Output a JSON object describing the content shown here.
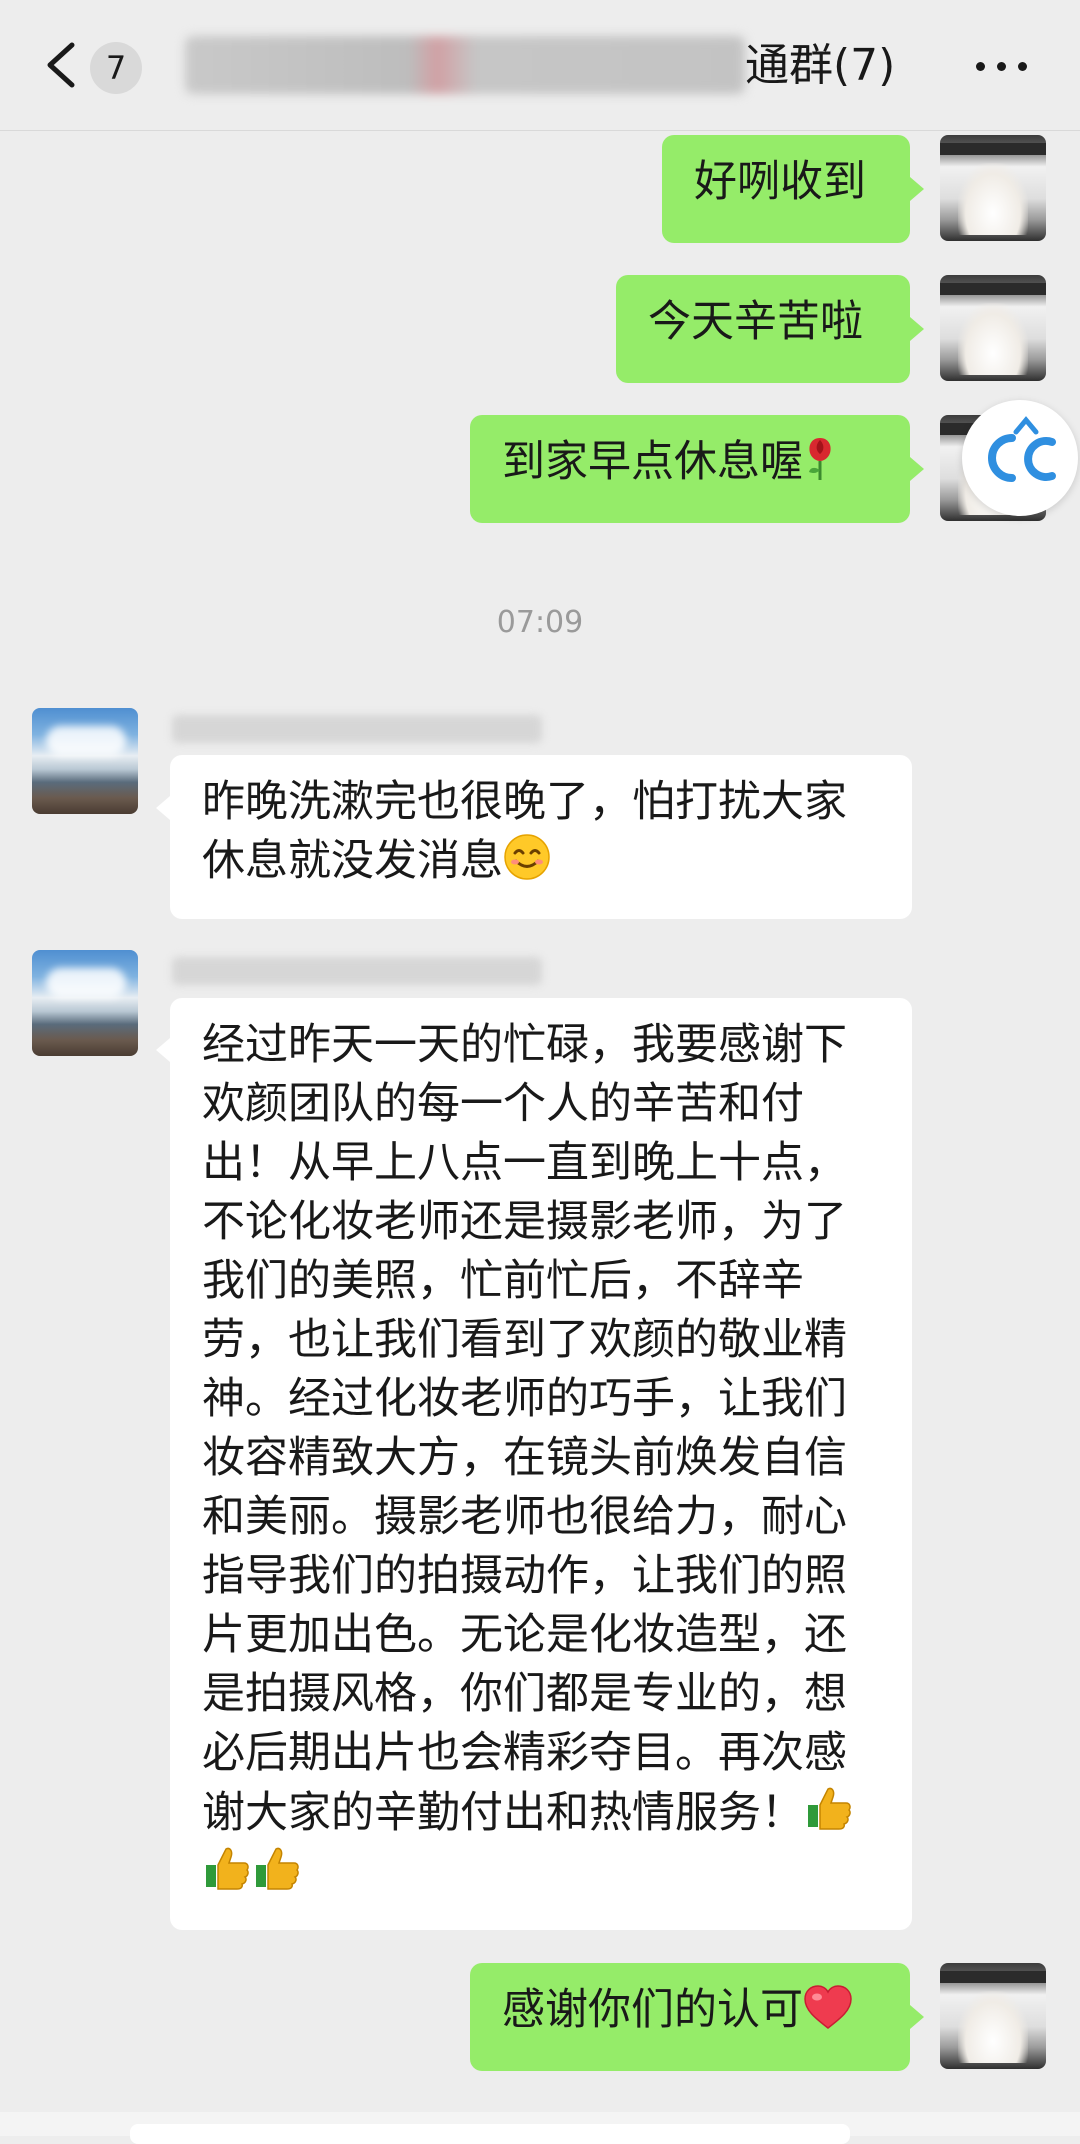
{
  "header": {
    "unread_count": "7",
    "title_visible": "通群(7)"
  },
  "timestamp": "07:09",
  "messages": [
    {
      "side": "self",
      "text": "好咧收到",
      "emoji": ""
    },
    {
      "side": "self",
      "text": "今天辛苦啦",
      "emoji": ""
    },
    {
      "side": "self",
      "text": "到家早点休息喔",
      "emoji": "rose"
    },
    {
      "side": "other",
      "text": "昨晚洗漱完也很晚了，怕打扰大家\n休息就没发消息",
      "emoji": "smile"
    },
    {
      "side": "other",
      "text": "经过昨天一天的忙碌，我要感谢下\n欢颜团队的每一个人的辛苦和付\n出！从早上八点一直到晚上十点，\n不论化妆老师还是摄影老师，为了\n我们的美照，忙前忙后，不辞辛\n劳，也让我们看到了欢颜的敬业精\n神。经过化妆老师的巧手，让我们\n妆容精致大方，在镜头前焕发自信\n和美丽。摄影老师也很给力，耐心\n指导我们的拍摄动作，让我们的照\n片更加出色。无论是化妆造型，还\n是拍摄风格，你们都是专业的，想\n必后期出片也会精彩夺目。再次感\n谢大家的辛勤付出和热情服务！",
      "emoji": "thumbs"
    },
    {
      "side": "self",
      "text": "感谢你们的认可",
      "emoji": "heart"
    }
  ],
  "floating_badge": "CC",
  "icons": {
    "back": "chevron-left-icon",
    "more": "more-dots-icon",
    "rose": "rose-emoji-icon",
    "smile": "smile-emoji-icon",
    "thumbs": "thumbs-up-emoji-icon",
    "heart": "heart-emoji-icon"
  },
  "colors": {
    "self_bubble": "#95ec69",
    "other_bubble": "#ffffff",
    "background": "#ededed"
  }
}
